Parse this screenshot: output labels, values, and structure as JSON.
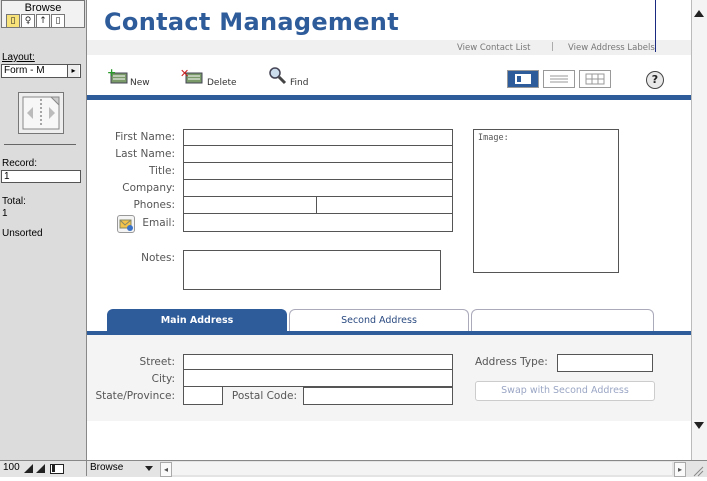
{
  "status_area": {
    "mode": "Browse",
    "layout_label": "Layout:",
    "layout_value": "Form - M",
    "record_label": "Record:",
    "record_value": "1",
    "total_label": "Total:",
    "total_value": "1",
    "sort_status": "Unsorted"
  },
  "header": {
    "title": "Contact Management",
    "links": [
      "View Contact List",
      "View Address Labels"
    ],
    "link_separator": "|"
  },
  "toolbar": {
    "new_label": "New",
    "delete_label": "Delete",
    "find_label": "Find"
  },
  "contact_form": {
    "first_name_label": "First Name:",
    "last_name_label": "Last Name:",
    "title_label": "Title:",
    "company_label": "Company:",
    "phones_label": "Phones:",
    "email_label": "Email:",
    "notes_label": "Notes:",
    "image_label": "Image:"
  },
  "tabs": [
    "Main Address",
    "Second Address",
    ""
  ],
  "address_form": {
    "street_label": "Street:",
    "city_label": "City:",
    "state_label": "State/Province:",
    "postal_label": "Postal Code:",
    "address_type_label": "Address Type:",
    "swap_button": "Swap with Second Address"
  },
  "bottom_bar": {
    "zoom": "100",
    "mode_select": "Browse"
  },
  "colors": {
    "brand_blue": "#2e5b9a",
    "status_bg": "#dcdcdc"
  }
}
